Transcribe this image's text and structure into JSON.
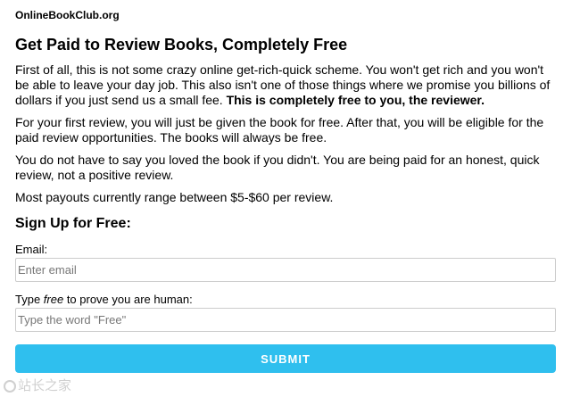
{
  "site": {
    "name": "OnlineBookClub.org"
  },
  "headline": "Get Paid to Review Books, Completely Free",
  "paragraphs": {
    "p1_text": "First of all, this is not some crazy online get-rich-quick scheme. You won't get rich and you won't be able to leave your day job. This also isn't one of those things where we promise you billions of dollars if you just send us a small fee. ",
    "p1_bold": "This is completely free to you, the reviewer.",
    "p2": "For your first review, you will just be given the book for free. After that, you will be eligible for the paid review opportunities. The books will always be free.",
    "p3": "You do not have to say you loved the book if you didn't. You are being paid for an honest, quick review, not a positive review.",
    "p4": "Most payouts currently range between $5-$60 per review."
  },
  "signup": {
    "heading": "Sign Up for Free:",
    "email_label": "Email:",
    "email_placeholder": "Enter email",
    "email_value": "",
    "human_label_prefix": "Type ",
    "human_label_emph": "free",
    "human_label_suffix": " to prove you are human:",
    "human_placeholder": "Type the word \"Free\"",
    "human_value": "",
    "submit_label": "SUBMIT"
  },
  "watermark": {
    "text": "站长之家"
  },
  "colors": {
    "submit_background": "#2fbfee",
    "submit_text": "#ffffff",
    "input_border": "#cccccc",
    "body_text": "#000000"
  }
}
